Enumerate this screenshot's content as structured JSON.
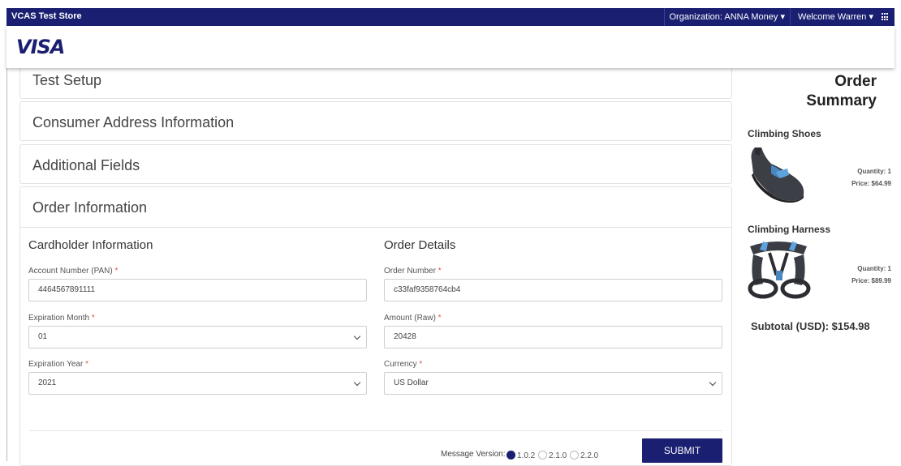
{
  "topbar": {
    "store_name": "VCAS Test Store",
    "organization_label": "Organization: ANNA Money",
    "welcome_label": "Welcome Warren"
  },
  "brand": {
    "logo_text": "VISA",
    "accent_color": "#1a1f71"
  },
  "sections": {
    "test_setup": "Test Setup",
    "consumer_address": "Consumer Address Information",
    "additional_fields": "Additional Fields",
    "order_information": "Order Information"
  },
  "cardholder": {
    "heading": "Cardholder Information",
    "pan_label": "Account Number (PAN)",
    "pan_value": "4464567891111",
    "exp_month_label": "Expiration Month",
    "exp_month_value": "01",
    "exp_year_label": "Expiration Year",
    "exp_year_value": "2021"
  },
  "order_details": {
    "heading": "Order Details",
    "order_number_label": "Order Number",
    "order_number_value": "c33faf9358764cb4",
    "amount_label": "Amount (Raw)",
    "amount_value": "20428",
    "currency_label": "Currency",
    "currency_value": "US Dollar"
  },
  "required_mark": "*",
  "message_version": {
    "label": "Message Version:",
    "options": [
      "1.0.2",
      "2.1.0",
      "2.2.0"
    ],
    "selected": "1.0.2"
  },
  "submit_label": "SUBMIT",
  "summary": {
    "title_line1": "Order",
    "title_line2": "Summary",
    "items": [
      {
        "name": "Climbing Shoes",
        "quantity": "Quantity: 1",
        "price": "Price: $64.99",
        "image": "climbing-shoe-image"
      },
      {
        "name": "Climbing Harness",
        "quantity": "Quantity: 1",
        "price": "Price: $89.99",
        "image": "climbing-harness-image"
      }
    ],
    "subtotal": "Subtotal (USD): $154.98"
  }
}
